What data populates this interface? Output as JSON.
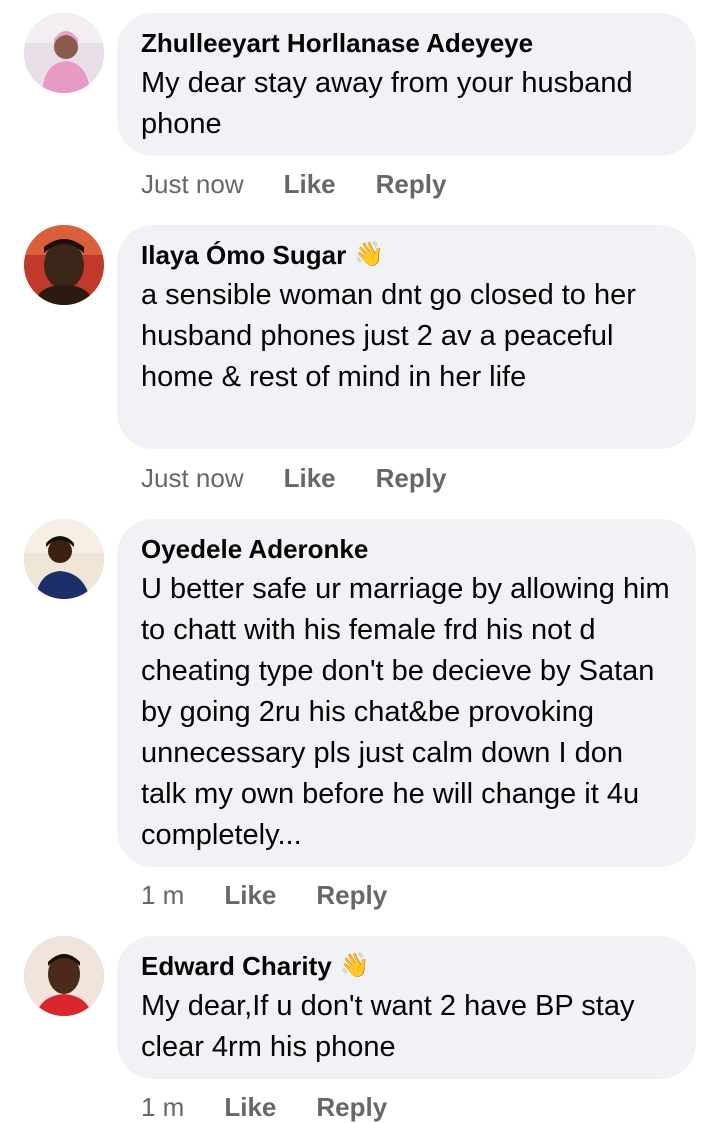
{
  "comments": [
    {
      "name": "Zhulleeyart Horllanase Adeyeye",
      "text": "My dear stay away from your husband phone",
      "time": "Just now",
      "like": "Like",
      "reply": "Reply",
      "has_wave": false
    },
    {
      "name": "Ilaya Ómo Sugar",
      "text": "a sensible woman dnt go closed to her husband phones just 2 av a peaceful home & rest of mind in her life",
      "time": "Just now",
      "like": "Like",
      "reply": "Reply",
      "has_wave": true
    },
    {
      "name": "Oyedele Aderonke",
      "text": "U better safe ur marriage by allowing him to chatt with his female frd his not d cheating type don't be decieve by Satan by going 2ru his chat&be provoking unnecessary pls just calm down I don talk my own before he will change it 4u completely...",
      "time": "1 m",
      "like": "Like",
      "reply": "Reply",
      "has_wave": false
    },
    {
      "name": "Edward Charity",
      "text": "My dear,If u don't want 2 have BP stay clear 4rm his phone",
      "time": "1 m",
      "like": "Like",
      "reply": "Reply",
      "has_wave": true
    }
  ],
  "icons": {
    "wave": "waving-hand-icon"
  }
}
